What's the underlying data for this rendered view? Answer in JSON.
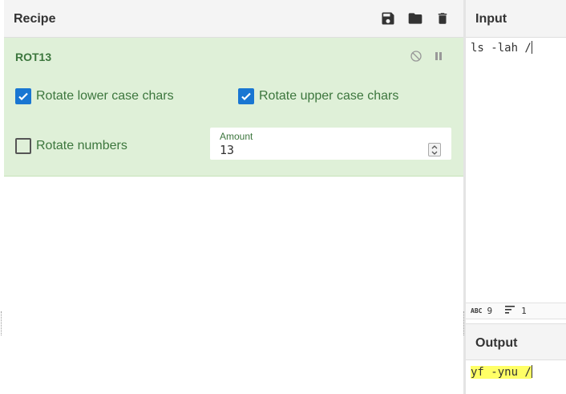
{
  "recipe": {
    "title": "Recipe",
    "actions": [
      {
        "name": "save-icon"
      },
      {
        "name": "folder-icon"
      },
      {
        "name": "trash-icon"
      }
    ]
  },
  "operation": {
    "title": "ROT13",
    "icons": [
      "disable-icon",
      "pause-icon"
    ],
    "rotate_lower": {
      "label": "Rotate lower case chars",
      "checked": true
    },
    "rotate_upper": {
      "label": "Rotate upper case chars",
      "checked": true
    },
    "rotate_numbers": {
      "label": "Rotate numbers",
      "checked": false
    },
    "amount": {
      "label": "Amount",
      "value": "13"
    }
  },
  "input": {
    "title": "Input",
    "text": "ls -lah /",
    "stats": {
      "chars": "9",
      "lines": "1"
    }
  },
  "output": {
    "title": "Output",
    "text": "yf -ynu /"
  },
  "colors": {
    "operation_bg": "#dff0d8",
    "operation_text": "#3c763d",
    "checkbox_on": "#1976d2",
    "output_highlight": "#ffff66"
  }
}
